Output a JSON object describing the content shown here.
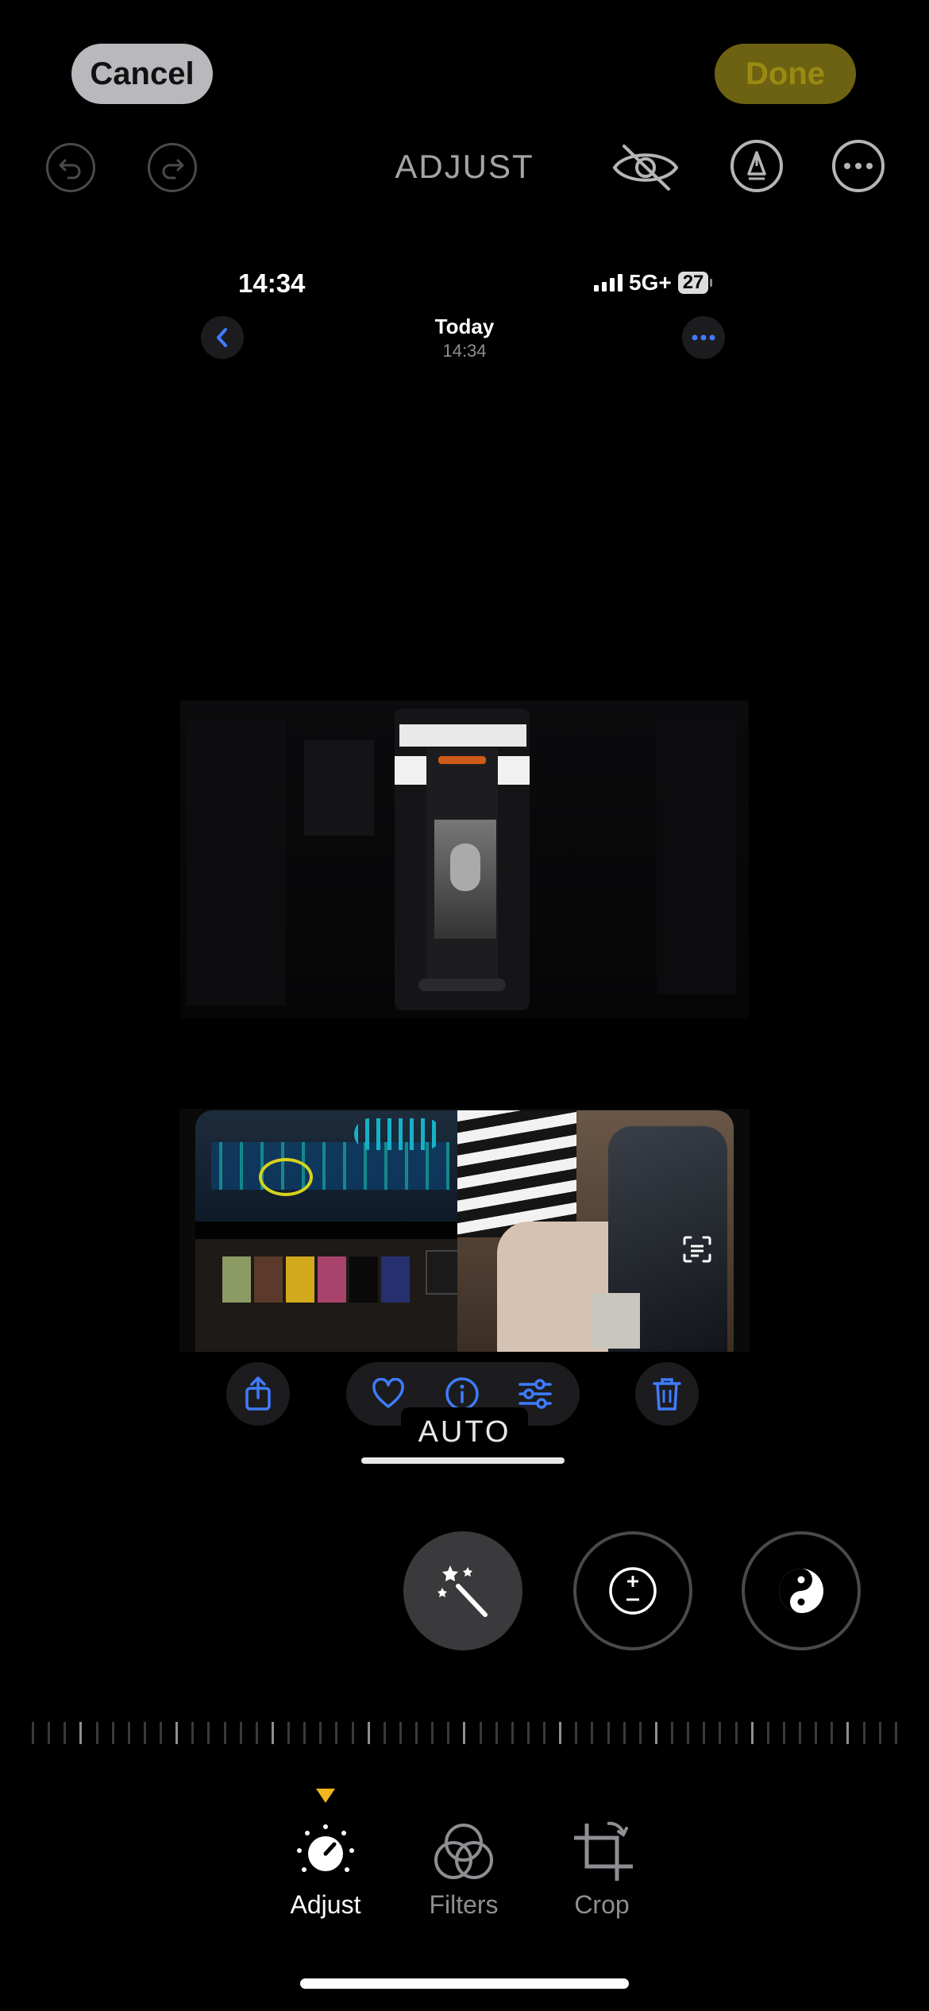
{
  "top_bar": {
    "cancel_label": "Cancel",
    "done_label": "Done",
    "title": "ADJUST",
    "icons": [
      "undo-icon",
      "redo-icon",
      "hide-icon",
      "markup-icon",
      "more-icon"
    ]
  },
  "inner_screenshot": {
    "status_time": "14:34",
    "network": "5G+",
    "battery": "27",
    "header_title": "Today",
    "header_subtitle": "14:34"
  },
  "photo_actions": {
    "icons": [
      "share-icon",
      "favorite-icon",
      "info-icon",
      "adjust-icon",
      "delete-icon"
    ]
  },
  "adjust": {
    "current_tool": "AUTO",
    "tools": [
      "auto-wand-icon",
      "exposure-icon",
      "brilliance-icon"
    ]
  },
  "tabs": [
    {
      "label": "Adjust",
      "active": true
    },
    {
      "label": "Filters",
      "active": false
    },
    {
      "label": "Crop",
      "active": false
    }
  ],
  "colors": {
    "accent": "#f2b51c",
    "link_blue": "#3f7cff",
    "done_bg": "#6d6212"
  }
}
